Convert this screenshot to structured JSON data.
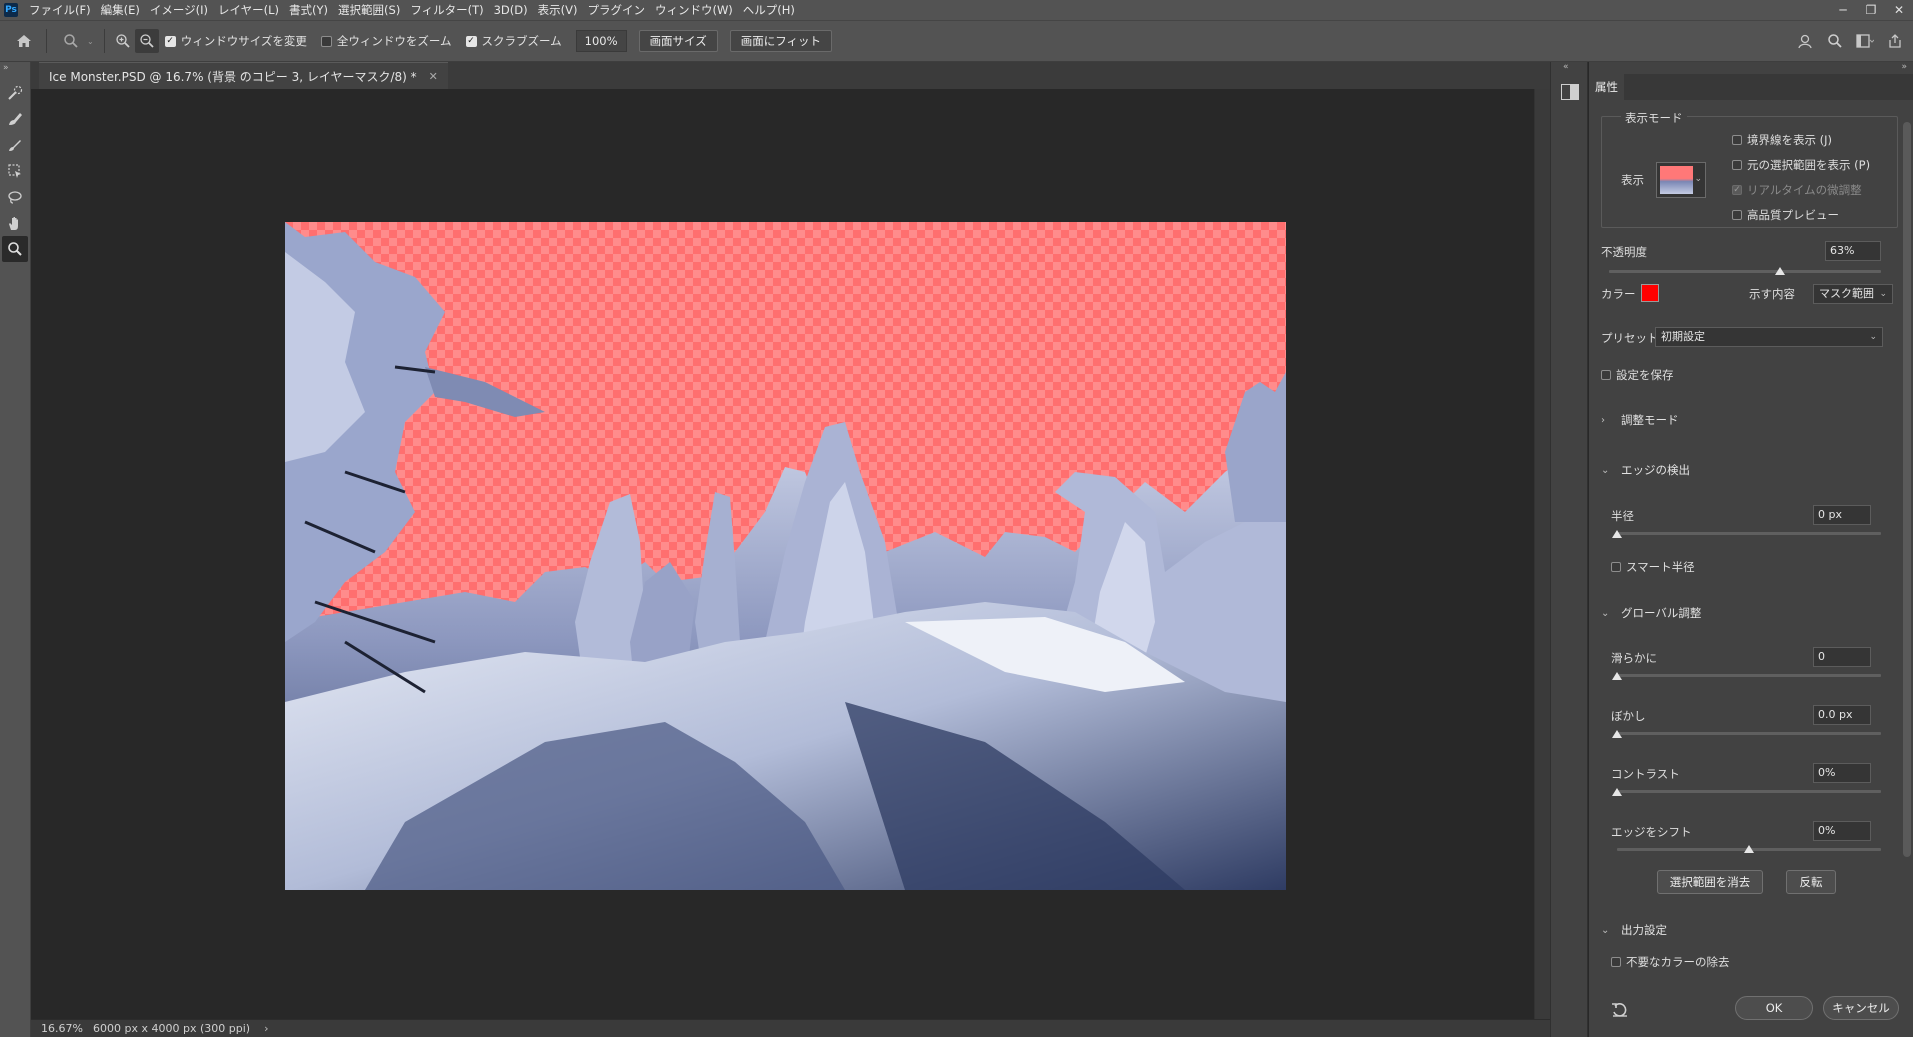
{
  "menubar": {
    "logo": "Ps",
    "items": [
      "ファイル(F)",
      "編集(E)",
      "イメージ(I)",
      "レイヤー(L)",
      "書式(Y)",
      "選択範囲(S)",
      "フィルター(T)",
      "3D(D)",
      "表示(V)",
      "プラグイン",
      "ウィンドウ(W)",
      "ヘルプ(H)"
    ],
    "window_controls": [
      "─",
      "❐",
      "✕"
    ]
  },
  "options": {
    "resize_windows_label": "ウィンドウサイズを変更",
    "resize_windows_checked": true,
    "zoom_all_label": "全ウィンドウをズーム",
    "zoom_all_checked": false,
    "scrubby_zoom_label": "スクラブズーム",
    "scrubby_zoom_checked": true,
    "zoom_percent": "100%",
    "fit_screen_label": "画面サイズ",
    "fill_screen_label": "画面にフィット"
  },
  "toolbar": {
    "tools": [
      "quick-selection-icon",
      "refine-edge-brush-icon",
      "brush-icon",
      "object-selection-icon",
      "lasso-icon",
      "hand-icon",
      "zoom-icon"
    ],
    "active_tool": "zoom-icon"
  },
  "document": {
    "tab_title": "Ice Monster.PSD @ 16.7% (背景 のコピー 3, レイヤーマスク/8) *",
    "overlay_color": "#ff6f6f"
  },
  "status": {
    "zoom": "16.67%",
    "doc_size": "6000 px x 4000 px (300 ppi)",
    "arrow": "›"
  },
  "properties": {
    "tab": "属性",
    "view_mode_title": "表示モード",
    "view_label": "表示",
    "show_edge_label": "境界線を表示 (J)",
    "show_edge_checked": false,
    "show_original_label": "元の選択範囲を表示 (P)",
    "show_original_checked": false,
    "realtime_label": "リアルタイムの微調整",
    "realtime_checked": true,
    "hq_preview_label": "高品質プレビュー",
    "hq_preview_checked": false,
    "opacity_label": "不透明度",
    "opacity_value": "63%",
    "opacity_level": 0.63,
    "color_label": "カラー",
    "overlay_swatch": "#ff0000",
    "indicates_label": "示す内容",
    "indicates_value": "マスク範囲",
    "preset_label": "プリセット",
    "preset_value": "初期設定",
    "remember_label": "設定を保存",
    "remember_checked": false,
    "adjust_mode_title": "調整モード",
    "edge_detection_title": "エッジの検出",
    "radius_label": "半径",
    "radius_value": "0 px",
    "radius_level": 0,
    "smart_radius_label": "スマート半径",
    "smart_radius_checked": false,
    "global_title": "グローバル調整",
    "smooth_label": "滑らかに",
    "smooth_value": "0",
    "smooth_level": 0,
    "feather_label": "ぼかし",
    "feather_value": "0.0 px",
    "feather_level": 0,
    "contrast_label": "コントラスト",
    "contrast_value": "0%",
    "contrast_level": 0,
    "shift_label": "エッジをシフト",
    "shift_value": "0%",
    "shift_level": 0.5,
    "clear_selection_label": "選択範囲を消去",
    "invert_label": "反転",
    "output_title": "出力設定",
    "decontaminate_label": "不要なカラーの除去",
    "decontaminate_checked": false,
    "ok_label": "OK",
    "cancel_label": "キャンセル"
  }
}
